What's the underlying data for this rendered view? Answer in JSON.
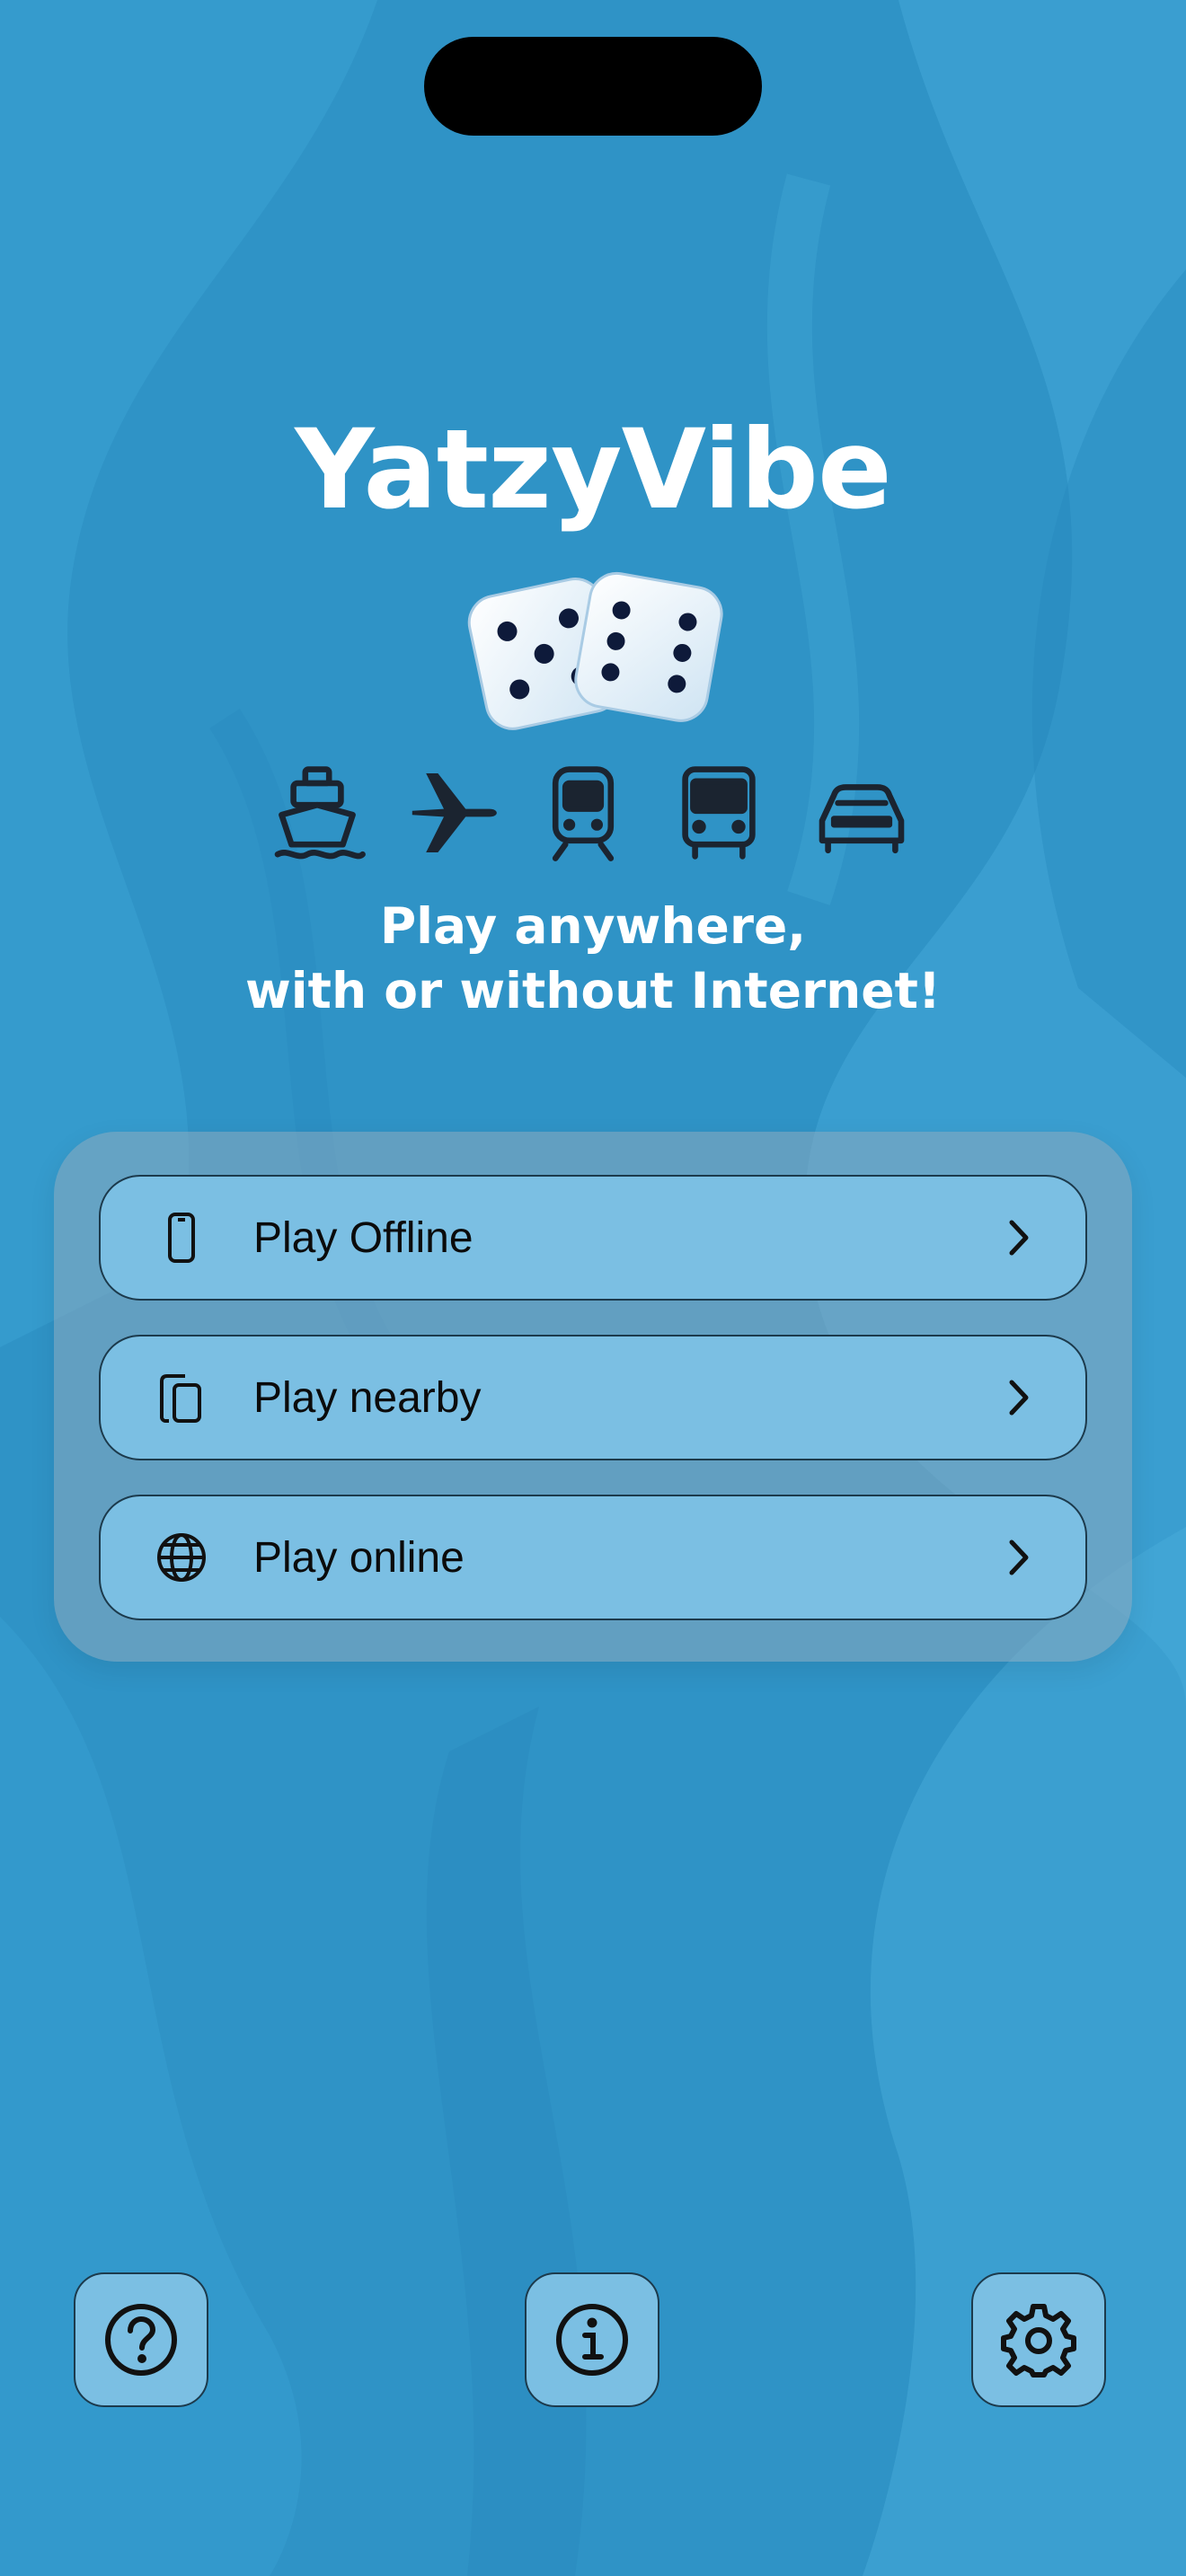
{
  "app": {
    "title": "YatzyVibe",
    "tagline_line1": "Play anywhere,",
    "tagline_line2": "with or without Internet!"
  },
  "transport_icons": [
    "ship-icon",
    "airplane-icon",
    "train-icon",
    "bus-icon",
    "car-icon"
  ],
  "menu": {
    "items": [
      {
        "label": "Play Offline",
        "icon": "phone-icon"
      },
      {
        "label": "Play nearby",
        "icon": "two-devices-icon"
      },
      {
        "label": "Play online",
        "icon": "globe-icon"
      }
    ]
  },
  "bottom_bar": {
    "buttons": [
      "help-icon",
      "info-icon",
      "settings-icon"
    ]
  },
  "colors": {
    "background": "#2f93c6",
    "button_fill": "#7bbfe3",
    "button_border": "#1c3a4c",
    "text_dark": "#0b0b0b",
    "title_text": "#ffffff"
  }
}
